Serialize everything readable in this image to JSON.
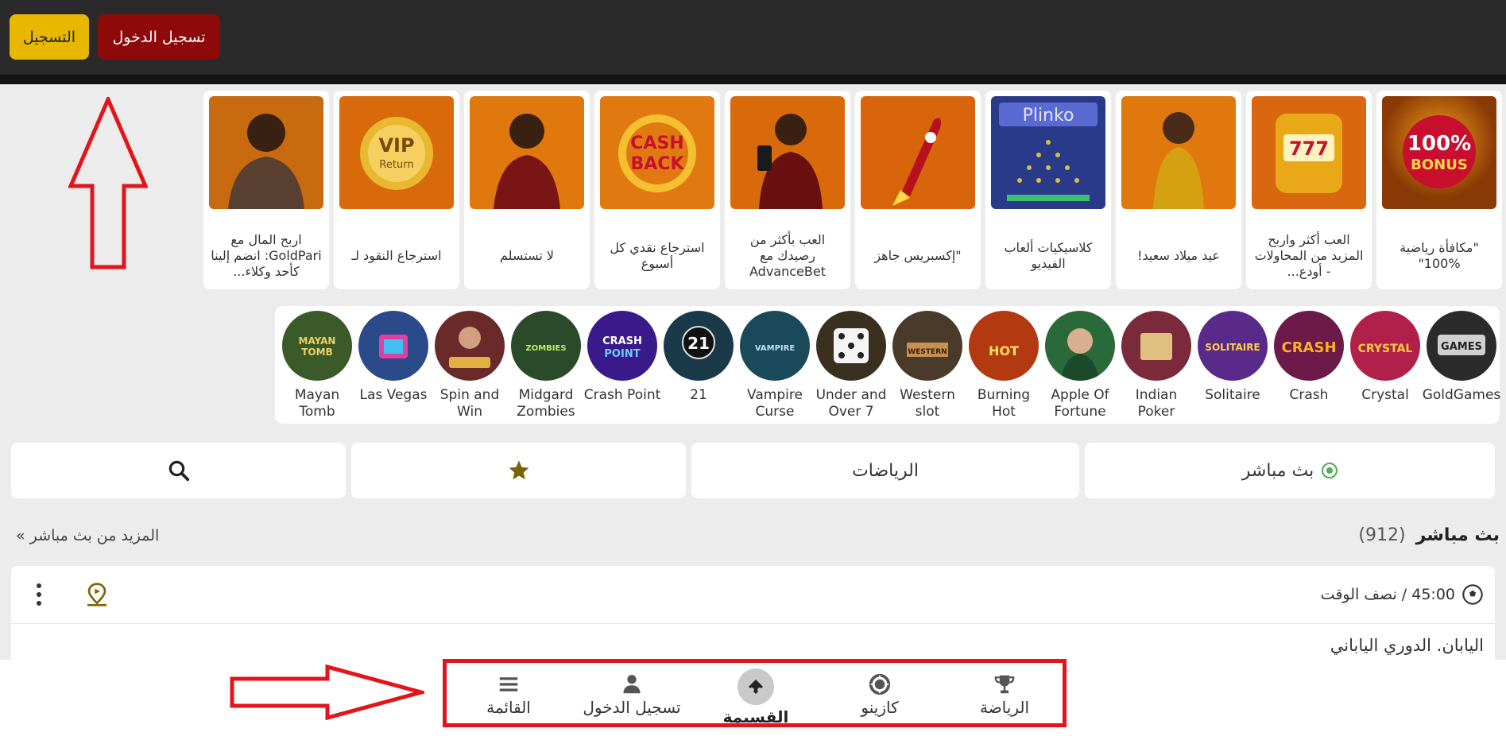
{
  "header": {
    "register_label": "التسجيل",
    "login_label": "تسجيل الدخول"
  },
  "promos": [
    {
      "text": "\"مكافأة رياضية %100\"",
      "icon": "bonus-100-icon"
    },
    {
      "text": "العب أكثر واربح المزيد من المحاولات - أودع...",
      "icon": "slot-777-icon"
    },
    {
      "text": "عيد ميلاد سعيد!",
      "icon": "birthday-woman-icon"
    },
    {
      "text": "كلاسيكيات ألعاب الفيديو",
      "icon": "plinko-icon"
    },
    {
      "text": "\"إكسبريس جاهز",
      "icon": "rocket-icon"
    },
    {
      "text": "العب بأكثر من رصيدك مع AdvanceBet",
      "icon": "advancebet-icon"
    },
    {
      "text": "استرجاع نقدي كل أسبوع",
      "icon": "cashback-icon"
    },
    {
      "text": "لا تستسلم",
      "icon": "man-phone-icon"
    },
    {
      "text": "استرجاع النقود لـ",
      "icon": "vip-return-icon"
    },
    {
      "text": "اربح المال مع GoldPari: انضم إلينا كأحد وكلاء...",
      "icon": "agent-man-icon"
    }
  ],
  "games": [
    {
      "label": "GoldGames",
      "color": "#2b2b2b"
    },
    {
      "label": "Crystal",
      "color": "#b0204a"
    },
    {
      "label": "Crash",
      "color": "#6b1a4a"
    },
    {
      "label": "Solitaire",
      "color": "#5a2a8a"
    },
    {
      "label": "Indian Poker",
      "color": "#7a2a3a"
    },
    {
      "label": "Apple Of Fortune",
      "color": "#2a6a3a"
    },
    {
      "label": "Burning Hot",
      "color": "#b33a10"
    },
    {
      "label": "Western slot",
      "color": "#4a3a2a"
    },
    {
      "label": "Under and Over 7",
      "color": "#3a3020"
    },
    {
      "label": "Vampire Curse",
      "color": "#1a4a5a"
    },
    {
      "label": "21",
      "color": "#1a3a4a"
    },
    {
      "label": "Crash Point",
      "color": "#3a1a8a"
    },
    {
      "label": "Midgard Zombies",
      "color": "#2a4a2a"
    },
    {
      "label": "Spin and Win",
      "color": "#6a2a2a"
    },
    {
      "label": "Las Vegas",
      "color": "#2a4a8a"
    },
    {
      "label": "Mayan Tomb",
      "color": "#3a5a2a"
    }
  ],
  "tabs": {
    "live": "بث مباشر",
    "sports": "الرياضات"
  },
  "live_section": {
    "title": "بث مباشر",
    "count": "(912)",
    "more": "المزيد من بث مباشر »"
  },
  "match": {
    "time": "45:00 / نصف الوقت",
    "league": "اليابان. الدوري الياباني"
  },
  "bottom_nav": {
    "sports": "الرياضة",
    "casino": "كازينو",
    "coupon": "القسيمة",
    "login": "تسجيل الدخول",
    "menu": "القائمة"
  },
  "colors": {
    "accent_yellow": "#e8b800",
    "accent_red": "#8e0a0a",
    "annotation_red": "#e3141b",
    "live_green": "#4caf50",
    "star_olive": "#7a6500"
  }
}
